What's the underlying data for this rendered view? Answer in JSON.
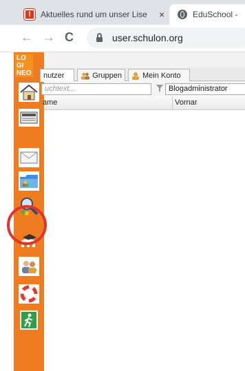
{
  "browser": {
    "tabs": [
      {
        "title": "Aktuelles rund um unser Lise",
        "close": "×"
      },
      {
        "title": "EduSchool -"
      }
    ],
    "nav": {
      "back": "←",
      "forward": "→",
      "reload": "C"
    },
    "url": "user.schulon.org"
  },
  "app": {
    "logo": {
      "lines": [
        "LO",
        "GI",
        "NEO"
      ]
    },
    "sidebar": {
      "items": [
        {
          "icon": "home-icon"
        },
        {
          "icon": "news-icon"
        },
        {
          "icon": "mail-icon"
        },
        {
          "icon": "folder-icon"
        },
        {
          "icon": "search-people-icon"
        },
        {
          "icon": "moodle-icon"
        },
        {
          "icon": "users-icon"
        },
        {
          "icon": "lifebuoy-icon"
        },
        {
          "icon": "exit-icon"
        }
      ]
    },
    "tabs": [
      {
        "label": "nutzer"
      },
      {
        "label": "Gruppen"
      },
      {
        "label": "Mein Konto"
      }
    ],
    "filter": {
      "search_placeholder": "uchtext...",
      "select_value": "Blogadministrator"
    },
    "table": {
      "columns": [
        "ame",
        "Vornar"
      ]
    }
  },
  "colors": {
    "sidebar": "#f07c22",
    "annotation": "#e0352b"
  }
}
